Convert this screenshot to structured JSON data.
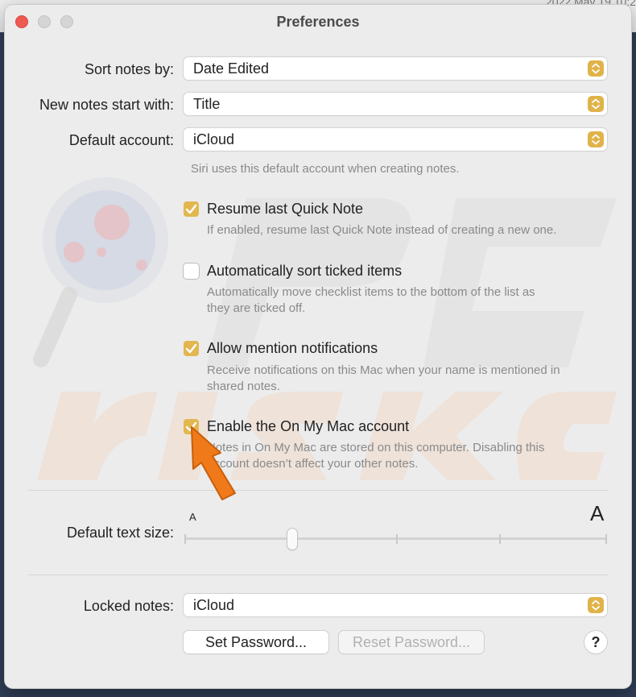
{
  "background": {
    "date_text": "2022 May 19 10:2"
  },
  "window": {
    "title": "Preferences",
    "controls": [
      "close",
      "minimize",
      "zoom"
    ]
  },
  "sort_notes": {
    "label": "Sort notes by:",
    "value": "Date Edited"
  },
  "new_notes": {
    "label": "New notes start with:",
    "value": "Title"
  },
  "default_account": {
    "label": "Default account:",
    "value": "iCloud",
    "hint": "Siri uses this default account when creating notes."
  },
  "options": [
    {
      "label": "Resume last Quick Note",
      "checked": true,
      "hint": "If enabled, resume last Quick Note instead of creating a new one."
    },
    {
      "label": "Automatically sort ticked items",
      "checked": false,
      "hint_lines": [
        "Automatically move checklist items to the bottom of the list as",
        "they are ticked off."
      ]
    },
    {
      "label": "Allow mention notifications",
      "checked": true,
      "hint_lines": [
        "Receive notifications on this Mac when your name is mentioned in",
        "shared notes."
      ]
    },
    {
      "label": "Enable the On My Mac account",
      "checked": true,
      "hint_lines": [
        "Notes in On My Mac are stored on this computer. Disabling this",
        "account doesn’t affect your other notes."
      ]
    }
  ],
  "text_size": {
    "label": "Default text size:",
    "small_glyph": "A",
    "large_glyph": "A",
    "level_fraction": 0.25,
    "steps": 5
  },
  "locked_notes": {
    "label": "Locked notes:",
    "value": "iCloud"
  },
  "buttons": {
    "set_password": "Set Password...",
    "reset_password": "Reset Password...",
    "help": "?"
  },
  "colors": {
    "accent": "#e2b74f",
    "close": "#ee5a52",
    "annotation_arrow": "#f07a1a"
  }
}
